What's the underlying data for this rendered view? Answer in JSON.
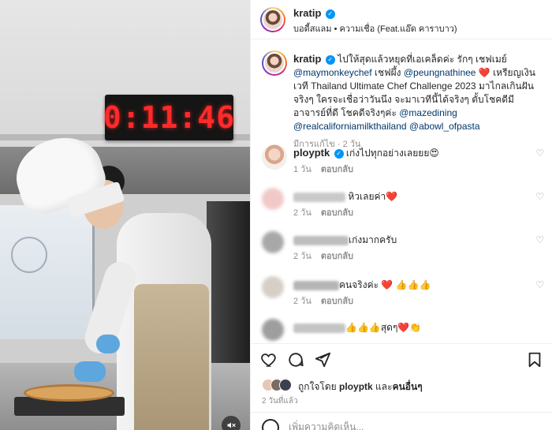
{
  "media": {
    "timer_display": "0:11:46",
    "mute_icon": "speaker-muted-icon"
  },
  "header": {
    "username": "kratip",
    "verified_mark": "✓",
    "subtitle": "บอดี้สแลม • ความเชื่อ (Feat.แอ๊ด คาราบาว)",
    "more_icon": "•••"
  },
  "caption": {
    "username": "kratip",
    "text_1": "ไปให้สุดแล้วหยุดที่เอเคล็ดค่ะ รักๆ เชฟเมย์",
    "mention_1": "@maymonkeychef",
    "text_2": " เชฟผึ้ง ",
    "mention_2": "@peungnathinee",
    "heart": " ❤️ ",
    "text_3": "เหรียญเงิน เวที Thailand Ultimate Chef Challenge 2023 มาไกลเกินฝันจริงๆ ใครจะเชื่อว่าวันนึง จะมาเวทีนี้ได้จริงๆ ตั้บโชคดีมีอาจารย์ที่ดี โชคดีจริงๆค่ะ ",
    "mention_3": "@mazedining",
    "mention_4": "@realcaliforniamilkthailand",
    "mention_5": "@abowl_ofpasta",
    "meta": "มีการแก้ไข · 2 วัน"
  },
  "comments": [
    {
      "username": "ployptk",
      "verified": true,
      "text": "เก่งไปทุกอย่างเลยยย😍",
      "time": "1 วัน",
      "reply": "ตอบกลับ"
    },
    {
      "username": "",
      "text": "หิวเลยค่า❤️",
      "time": "2 วัน",
      "reply": "ตอบกลับ"
    },
    {
      "username": "",
      "text": "เก่งมากครับ",
      "time": "2 วัน",
      "reply": "ตอบกลับ"
    },
    {
      "username": "",
      "text": "คนจริงค่ะ ❤️ 👍👍👍",
      "time": "2 วัน",
      "reply": "ตอบกลับ"
    },
    {
      "username": "",
      "text": "👍👍👍สุดๆ❤️👏",
      "time": "",
      "reply": ""
    }
  ],
  "actions": {
    "like_icon": "heart-outline-icon",
    "comment_icon": "comment-bubble-icon",
    "share_icon": "paper-plane-icon",
    "save_icon": "bookmark-icon"
  },
  "likes": {
    "prefix": "ถูกใจโดย ",
    "user": "ployptk",
    "middle": " และ",
    "others": "คนอื่นๆ"
  },
  "post_time": "2 วันที่แล้ว",
  "add_comment": {
    "placeholder": "เพิ่มความคิดเห็น..."
  },
  "colors": {
    "link": "#00376b",
    "verified": "#0095f6",
    "meta_gray": "#8e8e8e",
    "timer_red": "#ff2a2a"
  }
}
